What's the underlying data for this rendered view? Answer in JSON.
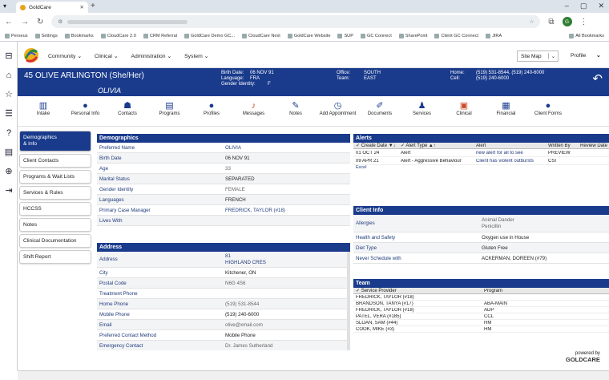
{
  "browser": {
    "tab_title": "GoldCare",
    "new_tab": "+",
    "bookmarks": [
      "Perseus",
      "Settings",
      "Bookmarks",
      "CloudCare 2.0",
      "CRM Referral",
      "GoldCare Demo GC...",
      "CloudCare Next",
      "GoldCare Website",
      "SUP",
      "GC Connect",
      "SharePoint",
      "Client GC Connect",
      "JIRA"
    ],
    "all_bookmarks": "All Bookmarks",
    "profile_letter": "G"
  },
  "app": {
    "menu": [
      "Community",
      "Clinical",
      "Administration",
      "System"
    ],
    "site_map": "Site Map",
    "profile": "Profile"
  },
  "patient": {
    "name": "45 OLIVE ARLINGTON (She/Her)",
    "preferred": "OLIVIA",
    "birth_date_label": "Birth Date:",
    "birth_date": "06 NOV 91",
    "language_label": "Language:",
    "language": "FRA",
    "gender_label": "Gender Identity:",
    "gender": "F",
    "office_label": "Office:",
    "office": "SOUTH",
    "team_label": "Team:",
    "team": "EAST",
    "home_label": "Home:",
    "home": "(519) 531-8544, (519) 240-6000",
    "cell_label": "Cell:",
    "cell": "(519) 240-6000"
  },
  "iconbar": [
    {
      "label": "Intake",
      "icon": "intake-icon",
      "glyph": "▥"
    },
    {
      "label": "Personal Info",
      "icon": "person-icon",
      "glyph": "●"
    },
    {
      "label": "Contacts",
      "icon": "contacts-icon",
      "glyph": "☗"
    },
    {
      "label": "Programs",
      "icon": "programs-icon",
      "glyph": "▤"
    },
    {
      "label": "Profiles",
      "icon": "profiles-icon",
      "glyph": "●"
    },
    {
      "label": "Messages",
      "icon": "bell-icon",
      "glyph": "♪"
    },
    {
      "label": "Notes",
      "icon": "notes-icon",
      "glyph": "✎"
    },
    {
      "label": "Add Appointment",
      "icon": "clock-icon",
      "glyph": "◷"
    },
    {
      "label": "Documents",
      "icon": "documents-icon",
      "glyph": "✐"
    },
    {
      "label": "Services",
      "icon": "services-icon",
      "glyph": "♟"
    },
    {
      "label": "Clinical",
      "icon": "clinical-icon",
      "glyph": "▣"
    },
    {
      "label": "Financial",
      "icon": "financial-icon",
      "glyph": "▦"
    },
    {
      "label": "Client Forms",
      "icon": "forms-icon",
      "glyph": "●"
    }
  ],
  "left_menu": [
    "Client Contacts",
    "Programs & Wait Lists",
    "Services & Rules",
    "HCCSS",
    "Notes",
    "Clinical Documentation",
    "Shift Report"
  ],
  "left_menu_active": [
    "Demographics",
    "& Info"
  ],
  "demographics": {
    "title": "Demographics",
    "rows": [
      {
        "label": "Preferred Name",
        "value": "OLIVIA",
        "style": "lnk"
      },
      {
        "label": "Birth Date",
        "value": "06 NOV 91",
        "style": "val"
      },
      {
        "label": "Age",
        "value": "33",
        "style": "muted"
      },
      {
        "label": "Marital Status",
        "value": "SEPARATED",
        "style": "val"
      },
      {
        "label": "Gender Identity",
        "value": "FEMALE",
        "style": "muted"
      },
      {
        "label": "Languages",
        "value": "FRENCH",
        "style": "val"
      },
      {
        "label": "Primary Case Manager",
        "value": "FREDRICK, TAYLOR (#18)",
        "style": "lnk"
      },
      {
        "label": "Lives With",
        "value": "",
        "style": "val"
      }
    ]
  },
  "address": {
    "title": "Address",
    "address_label": "Address",
    "address_line1": "81",
    "address_line2": "HIGHLAND CRES",
    "rows": [
      {
        "label": "City",
        "value": "Kitchener, ON",
        "style": "val"
      },
      {
        "label": "Postal Code",
        "value": "N6G 4S6",
        "style": "muted"
      },
      {
        "label": "Treatment Phone",
        "value": "",
        "style": "val"
      },
      {
        "label": "Home Phone",
        "value": "(519) 531-8544",
        "style": "muted"
      },
      {
        "label": "Mobile Phone",
        "value": "(519) 240-6000",
        "style": "val"
      },
      {
        "label": "Email",
        "value": "olive@xmail.com",
        "style": "muted"
      },
      {
        "label": "Preferred Contact Method",
        "value": "Mobile Phone",
        "style": "val"
      },
      {
        "label": "Emergency Contact",
        "value": "Dr. James Sutherland",
        "style": "muted"
      }
    ]
  },
  "alerts": {
    "title": "Alerts",
    "headers": [
      "Create Date",
      "Alert Type",
      "Alert",
      "Written By",
      "Review Date"
    ],
    "rows": [
      [
        "01 OCT 24",
        "Alert",
        "new alert for all to see",
        "PREVIEW",
        ""
      ],
      [
        "09 APR 21",
        "Alert - Aggressive Behaviour",
        "Client has violent outbursts",
        "CSI",
        ""
      ]
    ],
    "excel": "Excel"
  },
  "client_info": {
    "title": "Client Info",
    "allergies_label": "Allergies",
    "allergies": [
      "Animal Dander",
      "Penicillin"
    ],
    "rows": [
      {
        "label": "Health and Safety",
        "value": "Oxygen use in House"
      },
      {
        "label": "Diet Type",
        "value": "Gluten Free"
      },
      {
        "label": "Never Schedule with",
        "value": "ACKERMAN, DOREEN (#79)"
      }
    ]
  },
  "team": {
    "title": "Team",
    "headers": [
      "Service Provider",
      "Program"
    ],
    "rows": [
      [
        "FREDRICK, TAYLOR (#18)",
        ""
      ],
      [
        "BRANDSON, TANYA (#17)",
        "ABA-MAIN"
      ],
      [
        "FREDRICK, TAYLOR (#18)",
        "ADP"
      ],
      [
        "PATEL, VERA (#185)",
        "CCL"
      ],
      [
        "SLOAN, SAM (#44)",
        "HM"
      ],
      [
        "COOK, MIKE (#3)",
        "HM"
      ]
    ]
  },
  "powered": {
    "top": "powered by",
    "brand": "GOLDCARE"
  },
  "colors": {
    "brand_blue": "#1a3b8c",
    "link": "#1f3a7a"
  }
}
